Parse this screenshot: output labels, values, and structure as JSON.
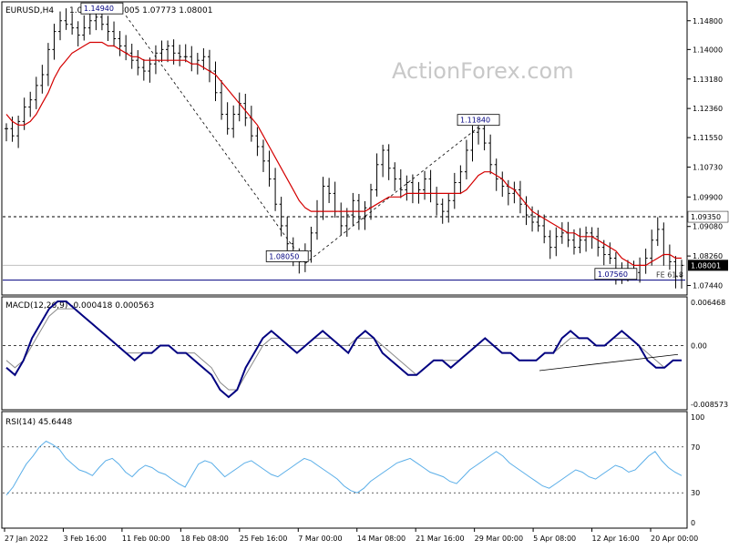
{
  "header": {
    "symbol": "EURUSD,H4",
    "ohlc": "1.07783 1.08005 1.07773 1.08001"
  },
  "watermark": "ActionForex.com",
  "colors": {
    "candle": "#000000",
    "ma": "#d40000",
    "macd": "#000080",
    "signal": "#8a8a8a",
    "rsi": "#5aaee8",
    "grid": "#000000",
    "line": "#000080"
  },
  "chart_data": [
    {
      "type": "line",
      "name": "price",
      "title": "EURUSD,H4 1.07783 1.08005 1.07773 1.08001",
      "y_ticks": [
        1.148,
        1.14,
        1.1318,
        1.1236,
        1.1155,
        1.1073,
        1.099,
        1.0908,
        1.0826,
        1.0744
      ],
      "y_tick_labels": [
        "1.14800",
        "1.14000",
        "1.13180",
        "1.12360",
        "1.11550",
        "1.10730",
        "1.09900",
        "1.09080",
        "1.08260",
        "1.07440"
      ],
      "ylim": [
        1.072,
        1.153
      ],
      "price_series": [
        1.118,
        1.116,
        1.12,
        1.124,
        1.126,
        1.13,
        1.133,
        1.14,
        1.145,
        1.148,
        1.147,
        1.146,
        1.144,
        1.146,
        1.148,
        1.149,
        1.147,
        1.145,
        1.143,
        1.141,
        1.139,
        1.137,
        1.135,
        1.134,
        1.136,
        1.139,
        1.14,
        1.141,
        1.139,
        1.138,
        1.138,
        1.136,
        1.137,
        1.138,
        1.134,
        1.128,
        1.122,
        1.118,
        1.122,
        1.125,
        1.121,
        1.116,
        1.113,
        1.109,
        1.104,
        1.097,
        1.091,
        1.086,
        1.083,
        1.081,
        1.084,
        1.089,
        1.095,
        1.102,
        1.1,
        1.095,
        1.091,
        1.094,
        1.098,
        1.093,
        1.096,
        1.101,
        1.108,
        1.112,
        1.107,
        1.104,
        1.101,
        1.103,
        1.1,
        1.101,
        1.104,
        1.1,
        1.097,
        1.095,
        1.098,
        1.103,
        1.106,
        1.112,
        1.117,
        1.118,
        1.114,
        1.108,
        1.104,
        1.102,
        1.1,
        1.101,
        1.097,
        1.094,
        1.092,
        1.091,
        1.088,
        1.085,
        1.088,
        1.089,
        1.087,
        1.085,
        1.087,
        1.089,
        1.088,
        1.085,
        1.083,
        1.082,
        1.078,
        1.079,
        1.078,
        1.078,
        1.08,
        1.082,
        1.087,
        1.09,
        1.083,
        1.081,
        1.077,
        1.08
      ],
      "ma_series": [
        1.122,
        1.12,
        1.119,
        1.119,
        1.12,
        1.122,
        1.125,
        1.128,
        1.132,
        1.135,
        1.137,
        1.139,
        1.14,
        1.141,
        1.142,
        1.142,
        1.142,
        1.141,
        1.141,
        1.14,
        1.139,
        1.138,
        1.138,
        1.137,
        1.137,
        1.137,
        1.137,
        1.137,
        1.137,
        1.137,
        1.137,
        1.136,
        1.136,
        1.135,
        1.134,
        1.133,
        1.131,
        1.129,
        1.127,
        1.125,
        1.123,
        1.121,
        1.119,
        1.116,
        1.113,
        1.11,
        1.107,
        1.104,
        1.101,
        1.098,
        1.096,
        1.095,
        1.095,
        1.095,
        1.095,
        1.095,
        1.095,
        1.095,
        1.095,
        1.095,
        1.095,
        1.096,
        1.097,
        1.098,
        1.099,
        1.099,
        1.099,
        1.1,
        1.1,
        1.1,
        1.1,
        1.1,
        1.1,
        1.1,
        1.1,
        1.1,
        1.1,
        1.101,
        1.103,
        1.105,
        1.106,
        1.106,
        1.105,
        1.104,
        1.102,
        1.101,
        1.099,
        1.097,
        1.095,
        1.094,
        1.093,
        1.092,
        1.091,
        1.09,
        1.089,
        1.089,
        1.088,
        1.088,
        1.088,
        1.087,
        1.086,
        1.085,
        1.084,
        1.082,
        1.081,
        1.08,
        1.08,
        1.08,
        1.081,
        1.082,
        1.083,
        1.083,
        1.082,
        1.082
      ],
      "labels": [
        {
          "text": "1.14940",
          "x": 16,
          "y": 1.1494
        },
        {
          "text": "1.11840",
          "x": 79,
          "y": 1.1184
        },
        {
          "text": "1.08050",
          "x": 47,
          "y": 1.0805
        },
        {
          "text": "1.07560",
          "x": 102,
          "y": 1.0756
        }
      ],
      "ref_lines": [
        {
          "value": 1.0935,
          "label": "1.09350",
          "style": "dashed"
        },
        {
          "value": 1.08001,
          "label": "1.08001",
          "style": "current"
        },
        {
          "value": 1.0759,
          "label": "FE 61.8",
          "style": "solid"
        }
      ],
      "trend_lines": [
        {
          "from_bar": 20,
          "from": 1.1494,
          "to_bar": 50,
          "to": 1.0805,
          "style": "dashed"
        },
        {
          "from_bar": 50,
          "from": 1.0805,
          "to_bar": 79,
          "to": 1.1184,
          "style": "dashed"
        }
      ]
    },
    {
      "type": "line",
      "name": "macd",
      "title": "MACD(12,26,9) -0.000418 0.000563",
      "y_tick_labels": [
        "0.006468",
        "0.00",
        "-0.008573"
      ],
      "ylim": [
        -0.0086,
        0.0065
      ],
      "macd": [
        -0.003,
        -0.004,
        -0.002,
        0.001,
        0.003,
        0.005,
        0.006,
        0.006,
        0.005,
        0.004,
        0.003,
        0.002,
        0.001,
        0.0,
        -0.001,
        -0.002,
        -0.001,
        -0.001,
        0.0,
        0.0,
        -0.001,
        -0.001,
        -0.002,
        -0.003,
        -0.004,
        -0.006,
        -0.007,
        -0.006,
        -0.003,
        -0.001,
        0.001,
        0.002,
        0.001,
        0.0,
        -0.001,
        0.0,
        0.001,
        0.002,
        0.001,
        0.0,
        -0.001,
        0.001,
        0.002,
        0.001,
        -0.001,
        -0.002,
        -0.003,
        -0.004,
        -0.004,
        -0.003,
        -0.002,
        -0.002,
        -0.003,
        -0.002,
        -0.001,
        0.0,
        0.001,
        0.0,
        -0.001,
        -0.001,
        -0.002,
        -0.002,
        -0.002,
        -0.001,
        -0.001,
        0.001,
        0.002,
        0.001,
        0.001,
        0.0,
        0.0,
        0.001,
        0.002,
        0.001,
        0.0,
        -0.002,
        -0.003,
        -0.003,
        -0.002,
        -0.002
      ],
      "signal": [
        -0.002,
        -0.003,
        -0.002,
        0.0,
        0.002,
        0.004,
        0.005,
        0.005,
        0.005,
        0.004,
        0.003,
        0.002,
        0.001,
        0.0,
        -0.001,
        -0.001,
        -0.001,
        -0.001,
        0.0,
        0.0,
        -0.001,
        -0.001,
        -0.001,
        -0.002,
        -0.003,
        -0.005,
        -0.006,
        -0.006,
        -0.004,
        -0.002,
        0.0,
        0.001,
        0.001,
        0.0,
        0.0,
        0.0,
        0.001,
        0.001,
        0.001,
        0.0,
        0.0,
        0.001,
        0.001,
        0.001,
        0.0,
        -0.001,
        -0.002,
        -0.003,
        -0.004,
        -0.003,
        -0.002,
        -0.002,
        -0.002,
        -0.002,
        -0.001,
        0.0,
        0.0,
        0.0,
        -0.001,
        -0.001,
        -0.002,
        -0.002,
        -0.002,
        -0.001,
        -0.001,
        0.0,
        0.001,
        0.001,
        0.001,
        0.0,
        0.0,
        0.001,
        0.001,
        0.001,
        0.0,
        -0.001,
        -0.002,
        -0.003,
        -0.002,
        -0.002
      ]
    },
    {
      "type": "line",
      "name": "rsi",
      "title": "RSI(14) 45.6448",
      "y_tick_labels": [
        "100",
        "70",
        "30",
        "0"
      ],
      "ylim": [
        0,
        100
      ],
      "ref_lines": [
        70,
        30
      ],
      "rsi": [
        28,
        35,
        45,
        55,
        62,
        70,
        75,
        72,
        68,
        60,
        55,
        50,
        48,
        45,
        52,
        58,
        60,
        55,
        48,
        44,
        50,
        54,
        52,
        48,
        46,
        42,
        38,
        35,
        45,
        55,
        58,
        56,
        50,
        44,
        48,
        52,
        56,
        58,
        54,
        50,
        46,
        44,
        48,
        52,
        56,
        60,
        58,
        54,
        50,
        46,
        42,
        36,
        32,
        30,
        34,
        40,
        44,
        48,
        52,
        56,
        58,
        60,
        56,
        52,
        48,
        46,
        44,
        40,
        38,
        44,
        50,
        54,
        58,
        62,
        66,
        62,
        56,
        52,
        48,
        44,
        40,
        36,
        34,
        38,
        42,
        46,
        50,
        48,
        44,
        42,
        46,
        50,
        54,
        52,
        48,
        50,
        56,
        62,
        66,
        58,
        52,
        48,
        45
      ]
    }
  ],
  "x_axis": {
    "tick_labels": [
      "27 Jan 2022",
      "3 Feb 16:00",
      "11 Feb 00:00",
      "18 Feb 08:00",
      "25 Feb 16:00",
      "7 Mar 00:00",
      "14 Mar 08:00",
      "21 Mar 16:00",
      "29 Mar 00:00",
      "5 Apr 08:00",
      "12 Apr 16:00",
      "20 Apr 00:00"
    ]
  }
}
